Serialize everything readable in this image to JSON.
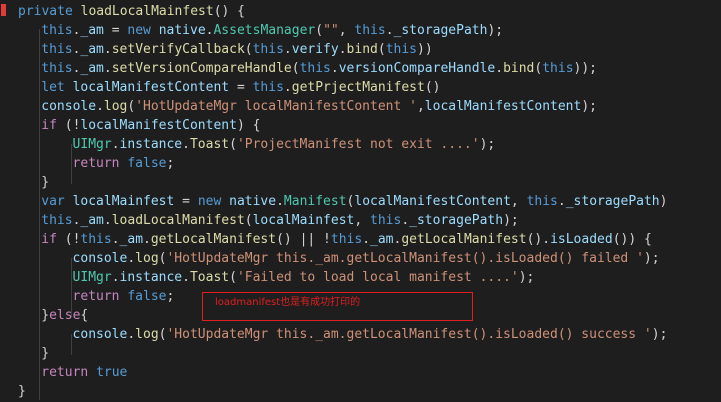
{
  "colors": {
    "background": "#1e1e1e",
    "default": "#d4d4d4",
    "keyword": "#569cd6",
    "function": "#dcdcaa",
    "variable": "#9cdcfe",
    "class": "#4ec9b0",
    "string": "#ce9178",
    "control": "#c586c0",
    "annotation": "#e02020",
    "gutter_mark": "#e03c3c"
  },
  "code": {
    "lines": [
      {
        "indent": 1,
        "tokens": [
          [
            "keyword",
            "private"
          ],
          [
            "default",
            " "
          ],
          [
            "function",
            "loadLocalMainfest"
          ],
          [
            "default",
            "() {"
          ]
        ]
      },
      {
        "indent": 4,
        "tokens": [
          [
            "keyword",
            "this"
          ],
          [
            "default",
            "."
          ],
          [
            "variable",
            "_am"
          ],
          [
            "default",
            " = "
          ],
          [
            "keyword",
            "new"
          ],
          [
            "default",
            " "
          ],
          [
            "variable",
            "native"
          ],
          [
            "default",
            "."
          ],
          [
            "class",
            "AssetsManager"
          ],
          [
            "default",
            "("
          ],
          [
            "string",
            "\"\""
          ],
          [
            "default",
            ", "
          ],
          [
            "keyword",
            "this"
          ],
          [
            "default",
            "."
          ],
          [
            "variable",
            "_storagePath"
          ],
          [
            "default",
            ");"
          ]
        ]
      },
      {
        "indent": 4,
        "tokens": [
          [
            "keyword",
            "this"
          ],
          [
            "default",
            "."
          ],
          [
            "variable",
            "_am"
          ],
          [
            "default",
            "."
          ],
          [
            "function",
            "setVerifyCallback"
          ],
          [
            "default",
            "("
          ],
          [
            "keyword",
            "this"
          ],
          [
            "default",
            "."
          ],
          [
            "variable",
            "verify"
          ],
          [
            "default",
            "."
          ],
          [
            "function",
            "bind"
          ],
          [
            "default",
            "("
          ],
          [
            "keyword",
            "this"
          ],
          [
            "default",
            "))"
          ]
        ]
      },
      {
        "indent": 4,
        "tokens": [
          [
            "keyword",
            "this"
          ],
          [
            "default",
            "."
          ],
          [
            "variable",
            "_am"
          ],
          [
            "default",
            "."
          ],
          [
            "function",
            "setVersionCompareHandle"
          ],
          [
            "default",
            "("
          ],
          [
            "keyword",
            "this"
          ],
          [
            "default",
            "."
          ],
          [
            "variable",
            "versionCompareHandle"
          ],
          [
            "default",
            "."
          ],
          [
            "function",
            "bind"
          ],
          [
            "default",
            "("
          ],
          [
            "keyword",
            "this"
          ],
          [
            "default",
            "));"
          ]
        ]
      },
      {
        "indent": 4,
        "tokens": [
          [
            "keyword",
            "let"
          ],
          [
            "default",
            " "
          ],
          [
            "variable",
            "localManifestContent"
          ],
          [
            "default",
            " = "
          ],
          [
            "keyword",
            "this"
          ],
          [
            "default",
            "."
          ],
          [
            "function",
            "getPrjectManifest"
          ],
          [
            "default",
            "()"
          ]
        ]
      },
      {
        "indent": 4,
        "tokens": [
          [
            "variable",
            "console"
          ],
          [
            "default",
            "."
          ],
          [
            "function",
            "log"
          ],
          [
            "default",
            "("
          ],
          [
            "string",
            "'HotUpdateMgr localManifestContent '"
          ],
          [
            "default",
            ","
          ],
          [
            "variable",
            "localManifestContent"
          ],
          [
            "default",
            ");"
          ]
        ]
      },
      {
        "indent": 4,
        "tokens": [
          [
            "control",
            "if"
          ],
          [
            "default",
            " (!"
          ],
          [
            "variable",
            "localManifestContent"
          ],
          [
            "default",
            ") {"
          ]
        ]
      },
      {
        "indent": 8,
        "tokens": [
          [
            "class",
            "UIMgr"
          ],
          [
            "default",
            "."
          ],
          [
            "variable",
            "instance"
          ],
          [
            "default",
            "."
          ],
          [
            "function",
            "Toast"
          ],
          [
            "default",
            "("
          ],
          [
            "string",
            "'ProjectManifest not exit ....'"
          ],
          [
            "default",
            ");"
          ]
        ]
      },
      {
        "indent": 8,
        "tokens": [
          [
            "control",
            "return"
          ],
          [
            "default",
            " "
          ],
          [
            "keyword",
            "false"
          ],
          [
            "default",
            ";"
          ]
        ]
      },
      {
        "indent": 4,
        "tokens": [
          [
            "default",
            "}"
          ]
        ]
      },
      {
        "indent": 4,
        "tokens": [
          [
            "keyword",
            "var"
          ],
          [
            "default",
            " "
          ],
          [
            "variable",
            "localMainfest"
          ],
          [
            "default",
            " = "
          ],
          [
            "keyword",
            "new"
          ],
          [
            "default",
            " "
          ],
          [
            "variable",
            "native"
          ],
          [
            "default",
            "."
          ],
          [
            "class",
            "Manifest"
          ],
          [
            "default",
            "("
          ],
          [
            "variable",
            "localManifestContent"
          ],
          [
            "default",
            ", "
          ],
          [
            "keyword",
            "this"
          ],
          [
            "default",
            "."
          ],
          [
            "variable",
            "_storagePath"
          ],
          [
            "default",
            ")"
          ]
        ]
      },
      {
        "indent": 4,
        "tokens": [
          [
            "keyword",
            "this"
          ],
          [
            "default",
            "."
          ],
          [
            "variable",
            "_am"
          ],
          [
            "default",
            "."
          ],
          [
            "function",
            "loadLocalManifest"
          ],
          [
            "default",
            "("
          ],
          [
            "variable",
            "localMainfest"
          ],
          [
            "default",
            ", "
          ],
          [
            "keyword",
            "this"
          ],
          [
            "default",
            "."
          ],
          [
            "variable",
            "_storagePath"
          ],
          [
            "default",
            ");"
          ]
        ]
      },
      {
        "indent": 4,
        "tokens": [
          [
            "control",
            "if"
          ],
          [
            "default",
            " (!"
          ],
          [
            "keyword",
            "this"
          ],
          [
            "default",
            "."
          ],
          [
            "variable",
            "_am"
          ],
          [
            "default",
            "."
          ],
          [
            "function",
            "getLocalManifest"
          ],
          [
            "default",
            "() || !"
          ],
          [
            "keyword",
            "this"
          ],
          [
            "default",
            "."
          ],
          [
            "variable",
            "_am"
          ],
          [
            "default",
            "."
          ],
          [
            "function",
            "getLocalManifest"
          ],
          [
            "default",
            "()."
          ],
          [
            "variable",
            "isLoaded"
          ],
          [
            "default",
            "()) {"
          ]
        ]
      },
      {
        "indent": 8,
        "tokens": [
          [
            "variable",
            "console"
          ],
          [
            "default",
            "."
          ],
          [
            "function",
            "log"
          ],
          [
            "default",
            "("
          ],
          [
            "string",
            "'HotUpdateMgr this._am.getLocalManifest().isLoaded() failed '"
          ],
          [
            "default",
            ");"
          ]
        ]
      },
      {
        "indent": 8,
        "tokens": [
          [
            "class",
            "UIMgr"
          ],
          [
            "default",
            "."
          ],
          [
            "variable",
            "instance"
          ],
          [
            "default",
            "."
          ],
          [
            "function",
            "Toast"
          ],
          [
            "default",
            "("
          ],
          [
            "string",
            "'Failed to load local manifest ....'"
          ],
          [
            "default",
            ");"
          ]
        ]
      },
      {
        "indent": 8,
        "tokens": [
          [
            "control",
            "return"
          ],
          [
            "default",
            " "
          ],
          [
            "keyword",
            "false"
          ],
          [
            "default",
            ";"
          ]
        ]
      },
      {
        "indent": 4,
        "tokens": [
          [
            "default",
            "}"
          ],
          [
            "control",
            "else"
          ],
          [
            "default",
            "{"
          ]
        ]
      },
      {
        "indent": 8,
        "tokens": [
          [
            "variable",
            "console"
          ],
          [
            "default",
            "."
          ],
          [
            "function",
            "log"
          ],
          [
            "default",
            "("
          ],
          [
            "string",
            "'HotUpdateMgr this._am.getLocalManifest().isLoaded() success '"
          ],
          [
            "default",
            ");"
          ]
        ]
      },
      {
        "indent": 4,
        "tokens": [
          [
            "default",
            "}"
          ]
        ]
      },
      {
        "indent": 4,
        "tokens": [
          [
            "control",
            "return"
          ],
          [
            "default",
            " "
          ],
          [
            "keyword",
            "true"
          ]
        ]
      },
      {
        "indent": 1,
        "tokens": [
          [
            "default",
            "}"
          ]
        ]
      }
    ]
  },
  "annotation": {
    "text": "loadmanifest也是有成功打印的"
  }
}
